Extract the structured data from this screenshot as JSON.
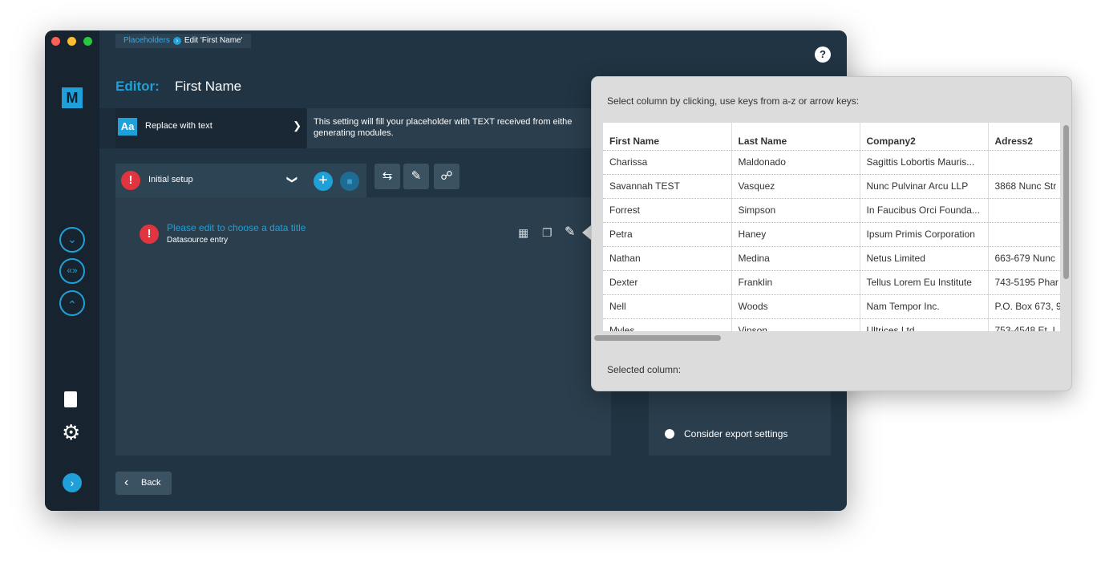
{
  "breadcrumb": {
    "link": "Placeholders",
    "current": "Edit 'First Name'"
  },
  "header": {
    "editor_label": "Editor:",
    "placeholder_name": "First Name",
    "help": "?"
  },
  "mode": {
    "icon_text": "Aa",
    "label": "Replace with text",
    "description_line1": "This setting will fill your placeholder with TEXT received from eithe",
    "description_line2": "generating modules."
  },
  "setup": {
    "label": "Initial setup"
  },
  "entry": {
    "title": "Please edit to choose a data title",
    "subtitle": "Datasource entry"
  },
  "options": {
    "consider_export": "Consider export settings"
  },
  "footer": {
    "back_label": "Back"
  },
  "popover": {
    "instruction": "Select column by clicking, use keys from a-z or arrow keys:",
    "selected_label": "Selected column:",
    "columns": [
      "First Name",
      "Last Name",
      "Company2",
      "Adress2"
    ],
    "rows": [
      [
        "Charissa",
        "Maldonado",
        "Sagittis Lobortis Mauris...",
        ""
      ],
      [
        "Savannah TEST",
        "Vasquez",
        "Nunc Pulvinar Arcu LLP",
        "3868 Nunc Str"
      ],
      [
        "Forrest",
        "Simpson",
        "In Faucibus Orci Founda...",
        ""
      ],
      [
        "Petra",
        "Haney",
        "Ipsum Primis Corporation",
        ""
      ],
      [
        "Nathan",
        "Medina",
        "Netus Limited",
        "663-679 Nunc"
      ],
      [
        "Dexter",
        "Franklin",
        "Tellus Lorem Eu Institute",
        "743-5195 Phar"
      ],
      [
        "Nell",
        "Woods",
        "Nam Tempor Inc.",
        "P.O. Box 673, 9"
      ],
      [
        "Myles",
        "Vinson",
        "Ultrices Ltd",
        "753-4548 Et. I"
      ]
    ]
  },
  "colors": {
    "accent": "#1fa0d8",
    "alert": "#e0343f",
    "background": "#1a2a38"
  }
}
